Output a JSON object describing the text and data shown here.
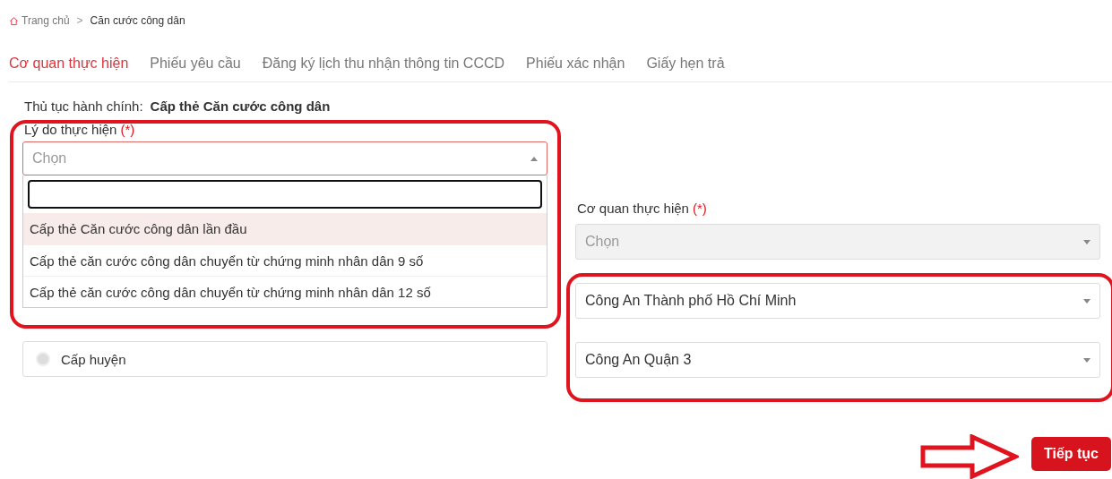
{
  "breadcrumb": {
    "items": [
      {
        "label": "Trang chủ",
        "kind": "home"
      },
      {
        "label": "Căn cước công dân",
        "kind": "current"
      }
    ],
    "separator": ">"
  },
  "tabs": [
    {
      "label": "Cơ quan thực hiện",
      "selected": true
    },
    {
      "label": "Phiếu yêu cầu",
      "selected": false
    },
    {
      "label": "Đăng ký lịch thu nhận thông tin CCCD",
      "selected": false
    },
    {
      "label": "Phiếu xác nhận",
      "selected": false
    },
    {
      "label": "Giấy hẹn trả",
      "selected": false
    }
  ],
  "procedure": {
    "label": "Thủ tục hành chính:",
    "value": "Cấp thẻ Căn cước công dân"
  },
  "reason": {
    "label": "Lý do thực hiện",
    "required": "(*)",
    "placeholder": "Chọn",
    "expanded": true,
    "options": [
      {
        "label": "Cấp thẻ Căn cước công dân lần đầu",
        "highlighted": true
      },
      {
        "label": "Cấp thẻ căn cước công dân chuyển từ chứng minh nhân dân 9 số",
        "highlighted": false
      },
      {
        "label": "Cấp thẻ căn cước công dân chuyển từ chứng minh nhân dân 12 số",
        "highlighted": false
      }
    ]
  },
  "level_option": {
    "label": "Cấp huyện",
    "checked": false
  },
  "agency": {
    "label": "Cơ quan thực hiện",
    "required": "(*)",
    "selects": [
      {
        "placeholder": "Chọn",
        "disabled": true
      },
      {
        "value": "Công An Thành phố Hồ Chí Minh",
        "disabled": false
      },
      {
        "value": "Công An Quận 3",
        "disabled": false
      }
    ]
  },
  "next_button": "Tiếp tục"
}
